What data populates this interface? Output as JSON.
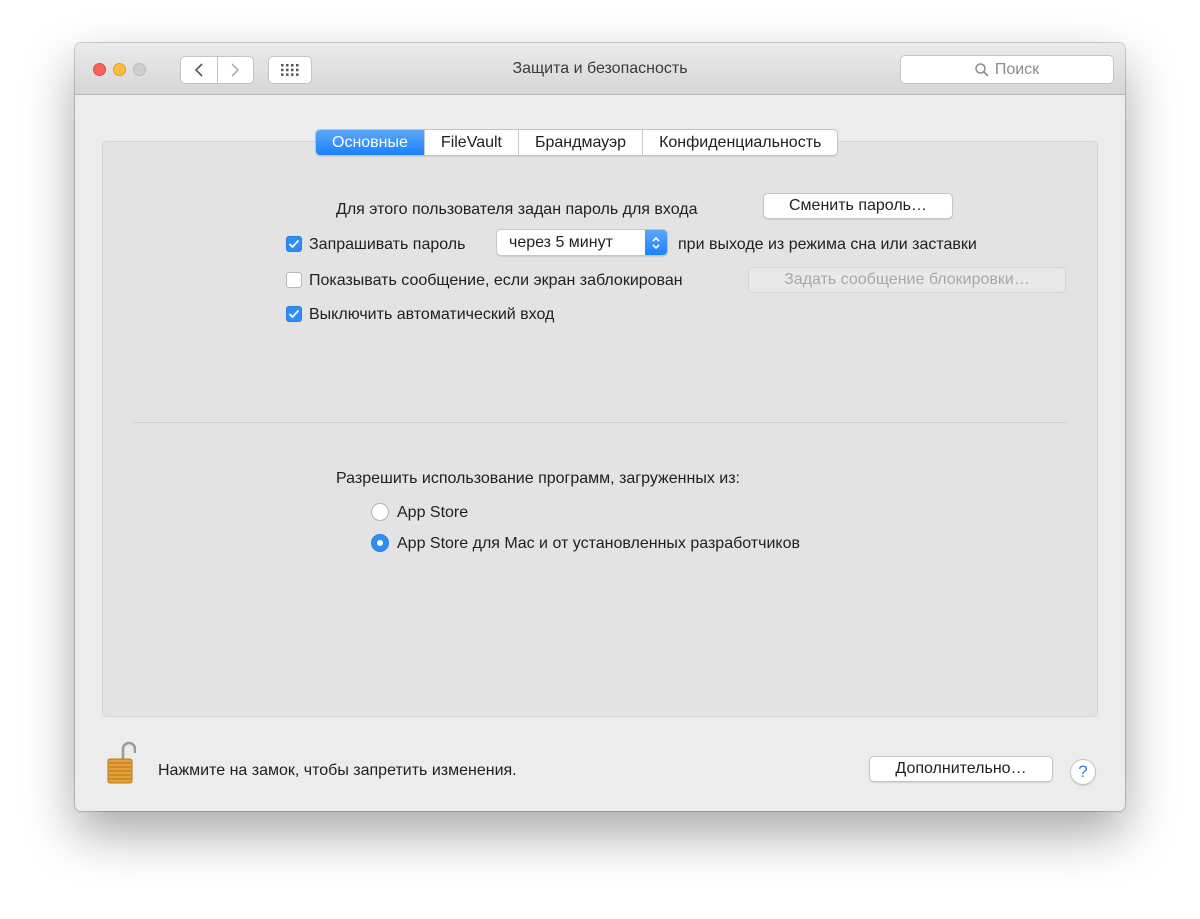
{
  "window": {
    "title": "Защита и безопасность",
    "search_placeholder": "Поиск"
  },
  "tabs": [
    {
      "label": "Основные",
      "active": true
    },
    {
      "label": "FileVault",
      "active": false
    },
    {
      "label": "Брандмауэр",
      "active": false
    },
    {
      "label": "Конфиденциальность",
      "active": false
    }
  ],
  "general": {
    "password_set_text": "Для этого пользователя задан пароль для входа",
    "change_password_button": "Сменить пароль…",
    "require_password": {
      "checked": true,
      "label": "Запрашивать пароль",
      "delay_value": "через 5 минут",
      "suffix": "при выходе из режима сна или заставки"
    },
    "show_message": {
      "checked": false,
      "label": "Показывать сообщение, если экран заблокирован",
      "button": "Задать сообщение блокировки…"
    },
    "disable_auto_login": {
      "checked": true,
      "label": "Выключить автоматический вход"
    }
  },
  "downloads": {
    "heading": "Разрешить использование программ, загруженных из:",
    "options": [
      {
        "label": "App Store",
        "selected": false
      },
      {
        "label": "App Store для Mac и от установленных разработчиков",
        "selected": true
      }
    ]
  },
  "footer": {
    "lock_text": "Нажмите на замок, чтобы запретить изменения.",
    "advanced_button": "Дополнительно…",
    "help_button": "?"
  },
  "colors": {
    "accent": "#2f8df6",
    "close": "#fc605c",
    "minimize": "#fdbc40",
    "zoom_disabled": "#cfcfcf"
  }
}
